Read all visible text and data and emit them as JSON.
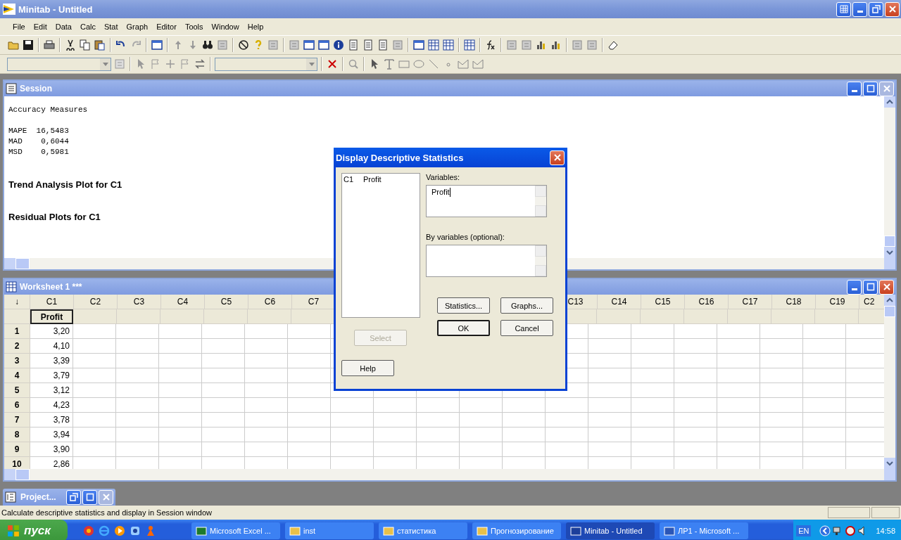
{
  "window": {
    "title": "Minitab - Untitled"
  },
  "menu": [
    "File",
    "Edit",
    "Data",
    "Calc",
    "Stat",
    "Graph",
    "Editor",
    "Tools",
    "Window",
    "Help"
  ],
  "session": {
    "title": "Session",
    "lines": [
      {
        "kind": "title",
        "text": "Accuracy Measures"
      },
      {
        "kind": "mono",
        "text": "MAPE  16,5483"
      },
      {
        "kind": "mono",
        "text": "MAD    0,6044"
      },
      {
        "kind": "mono",
        "text": "MSD    0,5981"
      },
      {
        "kind": "heading",
        "text": "Trend Analysis Plot for C1"
      },
      {
        "kind": "heading",
        "text": "Residual Plots for C1"
      }
    ]
  },
  "worksheet": {
    "title": "Worksheet 1 ***",
    "corner": "↓",
    "columns": [
      "C1",
      "C2",
      "C3",
      "C4",
      "C5",
      "C6",
      "C7",
      null,
      null,
      null,
      null,
      null,
      "C13",
      "C14",
      "C15",
      "C16",
      "C17",
      "C18",
      "C19",
      "C2"
    ],
    "names": [
      "Profit"
    ],
    "rows": [
      {
        "number": "1",
        "values": [
          "3,20"
        ]
      },
      {
        "number": "2",
        "values": [
          "4,10"
        ]
      },
      {
        "number": "3",
        "values": [
          "3,39"
        ]
      },
      {
        "number": "4",
        "values": [
          "3,79"
        ]
      },
      {
        "number": "5",
        "values": [
          "3,12"
        ]
      },
      {
        "number": "6",
        "values": [
          "4,23"
        ]
      },
      {
        "number": "7",
        "values": [
          "3,78"
        ]
      },
      {
        "number": "8",
        "values": [
          "3,94"
        ]
      },
      {
        "number": "9",
        "values": [
          "3,90"
        ]
      },
      {
        "number": "10",
        "values": [
          "2,86"
        ]
      }
    ]
  },
  "project": {
    "title": "Project..."
  },
  "dialog": {
    "title": "Display Descriptive Statistics",
    "list": [
      {
        "column": "C1",
        "name": "Profit"
      }
    ],
    "variables_label": "Variables:",
    "variables_value": "Profit",
    "by_label": "By variables (optional):",
    "buttons": [
      {
        "label": "Select",
        "disabled": true,
        "default": false
      },
      {
        "label": "Statistics...",
        "disabled": false,
        "default": false
      },
      {
        "label": "Graphs...",
        "disabled": false,
        "default": false
      },
      {
        "label": "Help",
        "disabled": false,
        "default": false
      },
      {
        "label": "OK",
        "disabled": false,
        "default": true
      },
      {
        "label": "Cancel",
        "disabled": false,
        "default": false
      }
    ]
  },
  "status_bar": "Calculate descriptive statistics and display in Session window",
  "taskbar": {
    "start": "пуск",
    "tasks": [
      {
        "label": "Microsoft Excel ...",
        "selected": false
      },
      {
        "label": "inst",
        "selected": false
      },
      {
        "label": "статистика",
        "selected": false
      },
      {
        "label": "Прогнозирование",
        "selected": false
      },
      {
        "label": "Minitab - Untitled",
        "selected": true
      },
      {
        "label": "ЛР1 - Microsoft ...",
        "selected": false
      }
    ],
    "language": "EN",
    "time": "14:58"
  }
}
